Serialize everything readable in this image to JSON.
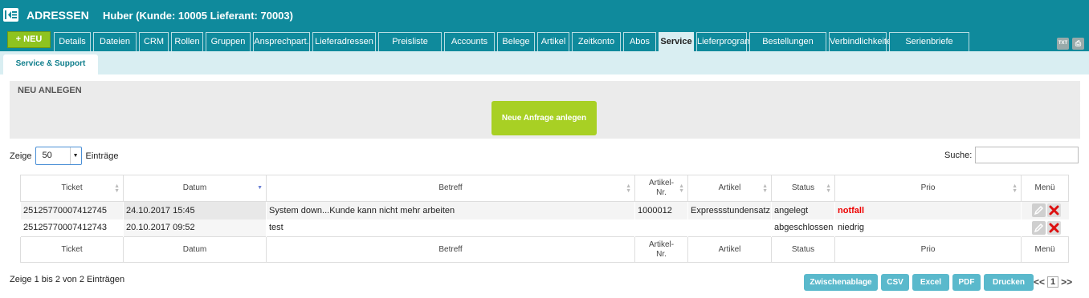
{
  "header": {
    "title": "ADRESSEN",
    "subtitle": "Huber (Kunde: 10005 Lieferant: 70003)",
    "new_label": "+ NEU",
    "txt_icon": "TXT"
  },
  "tabs": [
    "Details",
    "Dateien",
    "CRM",
    "Rollen",
    "Gruppen",
    "Ansprechpart.",
    "Lieferadressen",
    "Preisliste",
    "Accounts",
    "Belege",
    "Artikel",
    "Zeitkonto",
    "Abos",
    "Service",
    "Lieferprogramm",
    "Bestellungen",
    "Verbindlichkeiten",
    "Serienbriefe"
  ],
  "active_tab": "Service",
  "subtab": "Service & Support",
  "neu": {
    "title": "NEU ANLEGEN",
    "button": "Neue Anfrage anlegen"
  },
  "length": {
    "before": "Zeige",
    "value": "50",
    "after": "Einträge"
  },
  "search": {
    "label": "Suche:",
    "value": ""
  },
  "table": {
    "columns": [
      "Ticket",
      "Datum",
      "Betreff",
      "Artikel-\nNr.",
      "Artikel",
      "Status",
      "Prio",
      "Menü"
    ],
    "rows": [
      {
        "ticket": "25125770007412745",
        "datum": "24.10.2017 15:45",
        "betreff": "System down...Kunde kann nicht mehr arbeiten",
        "artikelnr": "1000012",
        "artikel": "Expressstundensatz",
        "status": "angelegt",
        "prio": "notfall"
      },
      {
        "ticket": "25125770007412743",
        "datum": "20.10.2017 09:52",
        "betreff": "test",
        "artikelnr": "",
        "artikel": "",
        "status": "abgeschlossen",
        "prio": "niedrig"
      }
    ]
  },
  "info": "Zeige 1 bis 2 von 2 Einträgen",
  "export_buttons": [
    "Zwischenablage",
    "CSV",
    "Excel",
    "PDF",
    "Drucken"
  ],
  "pagination": {
    "prev": "<<",
    "page": "1",
    "next": ">>"
  },
  "colors": {
    "header": "#0f8a9c",
    "accent_green": "#8fc31f",
    "button_teal": "#5ab9cc",
    "prio_urgent": "#e00000"
  }
}
